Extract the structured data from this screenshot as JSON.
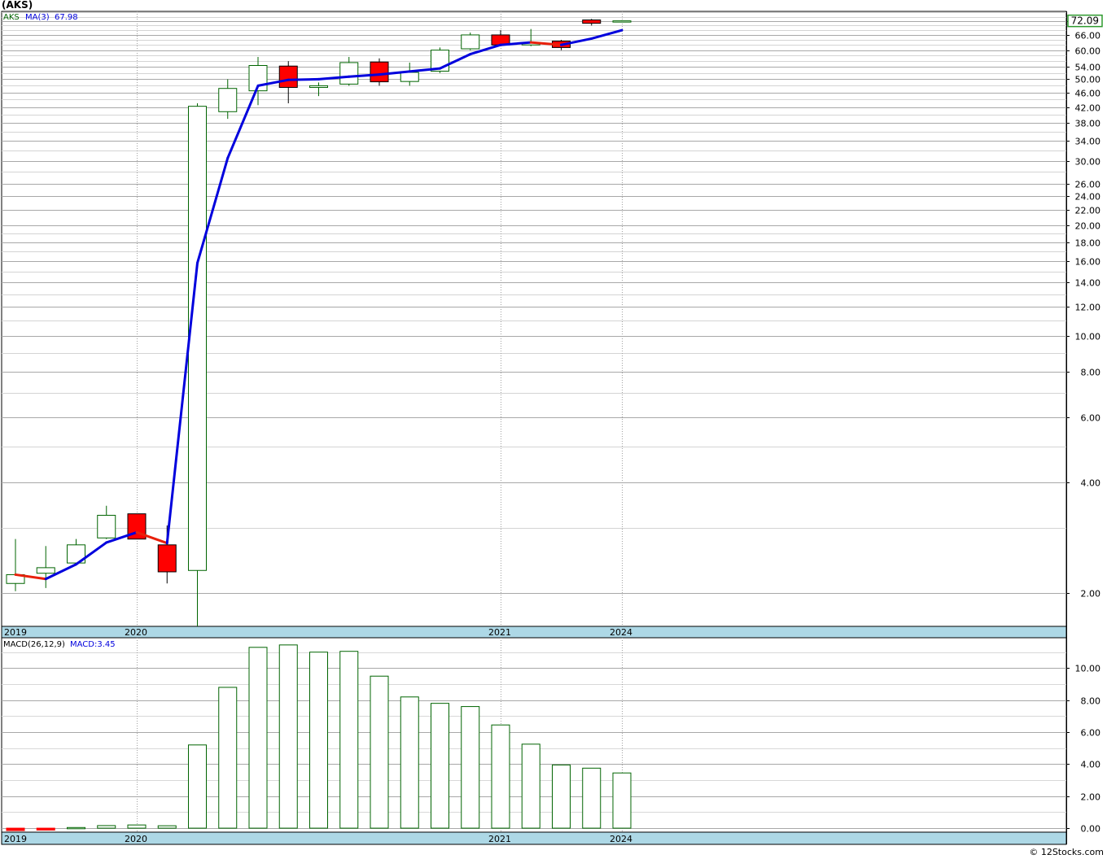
{
  "header": {
    "title": "(AKS)"
  },
  "footer": {
    "watermark": "© 12Stocks.com"
  },
  "colors": {
    "up": "#006400",
    "down": "#ff0000",
    "ma": "#0000dd",
    "ma_down": "#e8200a",
    "time_band": "#add8e6",
    "grid": "#c8c8c8"
  },
  "chart_data": [
    {
      "type": "candlestick",
      "scale": "log",
      "legend": {
        "symbol": "AKS",
        "ma_label": "MA(3)",
        "ma_value": "67.98"
      },
      "last_price_label": "72.09",
      "ylim": [
        1.62,
        76.5
      ],
      "y_ticks": [
        "72.00",
        "66.00",
        "60.00",
        "54.00",
        "50.00",
        "46.00",
        "42.00",
        "38.00",
        "34.00",
        "30.00",
        "26.00",
        "24.00",
        "22.00",
        "20.00",
        "18.00",
        "16.00",
        "14.00",
        "12.00",
        "10.00",
        "8.00",
        "6.00",
        "4.00",
        "2.00"
      ],
      "x_labels": [
        "2019",
        "2020",
        "2021",
        "2024"
      ],
      "x_label_index": [
        0,
        4,
        16,
        20
      ],
      "candles": [
        {
          "o": 2.12,
          "h": 2.8,
          "l": 2.02,
          "c": 2.24
        },
        {
          "o": 2.26,
          "h": 2.68,
          "l": 2.06,
          "c": 2.34
        },
        {
          "o": 2.41,
          "h": 2.8,
          "l": 2.38,
          "c": 2.7
        },
        {
          "o": 2.82,
          "h": 3.45,
          "l": 2.8,
          "c": 3.25
        },
        {
          "o": 3.28,
          "h": 3.28,
          "l": 2.8,
          "c": 2.8
        },
        {
          "o": 2.7,
          "h": 3.05,
          "l": 2.12,
          "c": 2.28
        },
        {
          "o": 2.3,
          "h": 43.0,
          "l": 1.62,
          "c": 42.2
        },
        {
          "o": 40.8,
          "h": 50.0,
          "l": 39.0,
          "c": 47.2
        },
        {
          "o": 46.5,
          "h": 57.5,
          "l": 42.5,
          "c": 54.5
        },
        {
          "o": 54.3,
          "h": 56.0,
          "l": 43.0,
          "c": 47.5
        },
        {
          "o": 47.5,
          "h": 49.0,
          "l": 45.0,
          "c": 48.0
        },
        {
          "o": 48.5,
          "h": 57.5,
          "l": 48.0,
          "c": 55.5
        },
        {
          "o": 55.7,
          "h": 57.0,
          "l": 48.0,
          "c": 49.2
        },
        {
          "o": 49.3,
          "h": 55.5,
          "l": 48.0,
          "c": 52.2
        },
        {
          "o": 52.6,
          "h": 61.0,
          "l": 52.0,
          "c": 60.0
        },
        {
          "o": 60.5,
          "h": 67.0,
          "l": 60.0,
          "c": 66.0
        },
        {
          "o": 66.0,
          "h": 68.0,
          "l": 61.5,
          "c": 62.0
        },
        {
          "o": 62.0,
          "h": 68.5,
          "l": 61.5,
          "c": 63.0
        },
        {
          "o": 63.5,
          "h": 64.0,
          "l": 60.0,
          "c": 61.0
        },
        {
          "o": 72.5,
          "h": 73.0,
          "l": 70.0,
          "c": 71.0
        },
        {
          "o": 72.09,
          "h": 72.3,
          "l": 71.9,
          "c": 72.09
        }
      ],
      "ma3": [
        2.24,
        2.18,
        2.39,
        2.74,
        2.92,
        2.73,
        15.8,
        30.5,
        48.0,
        49.8,
        50.0,
        50.8,
        51.5,
        52.5,
        53.5,
        58.5,
        62.0,
        63.0,
        62.0,
        64.5,
        67.98
      ]
    },
    {
      "type": "bar",
      "legend": {
        "label": "MACD(26,12,9)",
        "value_label": "MACD:3.45"
      },
      "ylim": [
        -0.25,
        11.9
      ],
      "y_ticks": [
        "10.00",
        "8.00",
        "6.00",
        "4.00",
        "2.00",
        "0.00"
      ],
      "x_labels": [
        "2019",
        "2020",
        "2021",
        "2024"
      ],
      "x_label_index": [
        0,
        4,
        16,
        20
      ],
      "values": [
        -0.15,
        -0.12,
        0.04,
        0.16,
        0.2,
        0.15,
        5.2,
        8.8,
        11.3,
        11.45,
        11.0,
        11.05,
        9.5,
        8.2,
        7.8,
        7.6,
        6.45,
        5.25,
        3.95,
        3.75,
        3.45
      ]
    }
  ]
}
